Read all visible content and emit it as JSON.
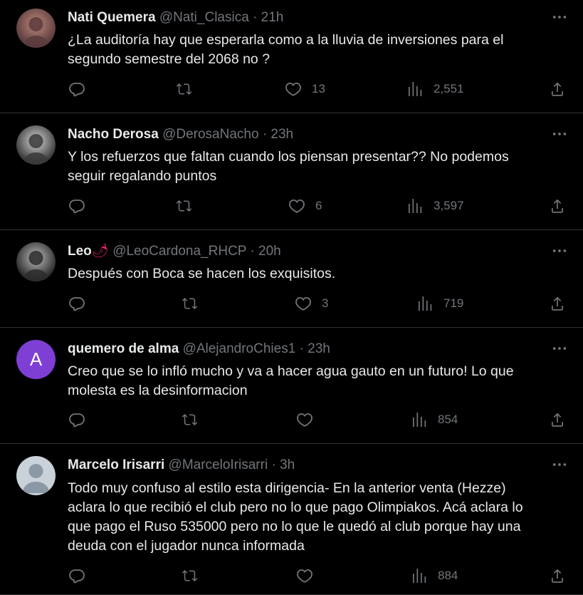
{
  "tweets": [
    {
      "name": "Nati Quemera",
      "handle": "@Nati_Clasica",
      "separator": "·",
      "time": "21h",
      "text_lines": [
        "¿La auditoría hay que esperarla como a la lluvia de inversiones para el",
        "segundo semestre del 2068 no ?"
      ],
      "likes": "13",
      "views": "2,551",
      "avatar_type": "photo",
      "avatar_colors": [
        "#5a3b3e",
        "#c08a7a"
      ]
    },
    {
      "name": "Nacho Derosa",
      "handle": "@DerosaNacho",
      "separator": "·",
      "time": "23h",
      "text_lines": [
        "Y los refuerzos que faltan cuando los piensan presentar?? No podemos",
        "seguir regalando puntos"
      ],
      "likes": "6",
      "views": "3,597",
      "avatar_type": "photo",
      "avatar_colors": [
        "#3a3a3a",
        "#d7d7d7"
      ]
    },
    {
      "name": "Leo",
      "name_emoji": "🌶",
      "handle": "@LeoCardona_RHCP",
      "separator": "·",
      "time": "20h",
      "text_lines": [
        "Después con Boca se hacen los exquisitos."
      ],
      "likes": "3",
      "views": "719",
      "avatar_type": "photo",
      "avatar_colors": [
        "#2b2b2b",
        "#bdbdbd"
      ]
    },
    {
      "name": "quemero de alma",
      "handle": "@AlejandroChies1",
      "separator": "·",
      "time": "23h",
      "text_lines": [
        "Creo que se lo infló mucho y va a hacer agua gauto en un futuro! Lo que",
        "molesta es la desinformacion"
      ],
      "likes": "",
      "views": "854",
      "avatar_type": "letter",
      "avatar_letter": "A",
      "avatar_colors": [
        "#7e3fd4"
      ]
    },
    {
      "name": "Marcelo Irisarri",
      "handle": "@MarceloIrisarri",
      "separator": "·",
      "time": "3h",
      "text_lines": [
        "Todo muy confuso al estilo esta dirigencia- En la anterior venta (Hezze)",
        "aclara lo que recibió el club pero no lo que pago Olimpiakos. Acá aclara lo",
        "que pago el Ruso 535000 pero no lo que le quedó al club porque hay una",
        "deuda con el jugador nunca informada"
      ],
      "likes": "",
      "views": "884",
      "avatar_type": "default",
      "avatar_colors": [
        "#c9d2d9"
      ]
    }
  ],
  "icons": {
    "reply": "reply-icon",
    "retweet": "retweet-icon",
    "like": "like-icon",
    "views": "views-icon",
    "share": "share-icon",
    "more": "more-icon"
  },
  "colors": {
    "background": "#000000",
    "text": "#e7e9ea",
    "muted": "#71767b",
    "divider": "#2f3336"
  }
}
